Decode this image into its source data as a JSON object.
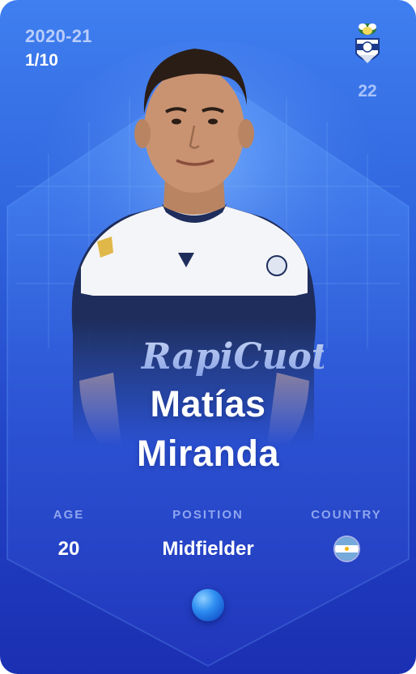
{
  "card": {
    "season": "2020-21",
    "serial": "1/10",
    "shirt_number": "22",
    "player_first_name": "Matías",
    "player_last_name": "Miranda"
  },
  "stats": {
    "age_label": "AGE",
    "age_value": "20",
    "position_label": "POSITION",
    "position_value": "Midfielder",
    "country_label": "COUNTRY"
  },
  "icons": {
    "club": "club-crest-icon",
    "country_flag": "argentina-flag-icon",
    "rarity": "rarity-gem-icon"
  },
  "colors": {
    "card_top": "#3f7ff0",
    "card_bottom": "#1b2fb2",
    "label": "#8ea6ee",
    "season_text": "#b9cdfb"
  }
}
